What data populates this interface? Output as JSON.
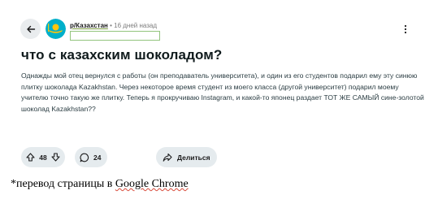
{
  "post": {
    "subreddit": "р/Казахстан",
    "separator": "•",
    "time_ago": "16 дней назад",
    "title": "что с казахским шоколадом?",
    "body": "Однажды мой отец вернулся с работы (он преподаватель университета), и один из его студентов подарил ему эту синюю плитку шоколада Kazakhstan. Через некоторое время студент из моего класса (другой университет) подарил моему учителю точно такую же плитку. Теперь я прокручиваю Instagram, и какой-то японец раздает ТОТ ЖЕ САМЫЙ сине-золотой шоколад Kazakhstan??"
  },
  "actions": {
    "vote_count": "48",
    "comment_count": "24",
    "share_label": "Делиться"
  },
  "note": {
    "prefix": "*перевод страницы в ",
    "browser": "Google Chrome"
  },
  "colors": {
    "pill_bg": "#e5ebee",
    "back_bg": "#e9ecee",
    "flag_blue": "#00afca",
    "flag_gold": "#fec50c",
    "highlight_border": "#93c47d"
  },
  "icons": {
    "back": "arrow-left-icon",
    "avatar": "kazakhstan-flag-icon",
    "more": "ellipsis-vertical-icon",
    "upvote": "arrow-up-icon",
    "downvote": "arrow-down-icon",
    "comment": "speech-bubble-icon",
    "share": "share-arrow-icon"
  }
}
